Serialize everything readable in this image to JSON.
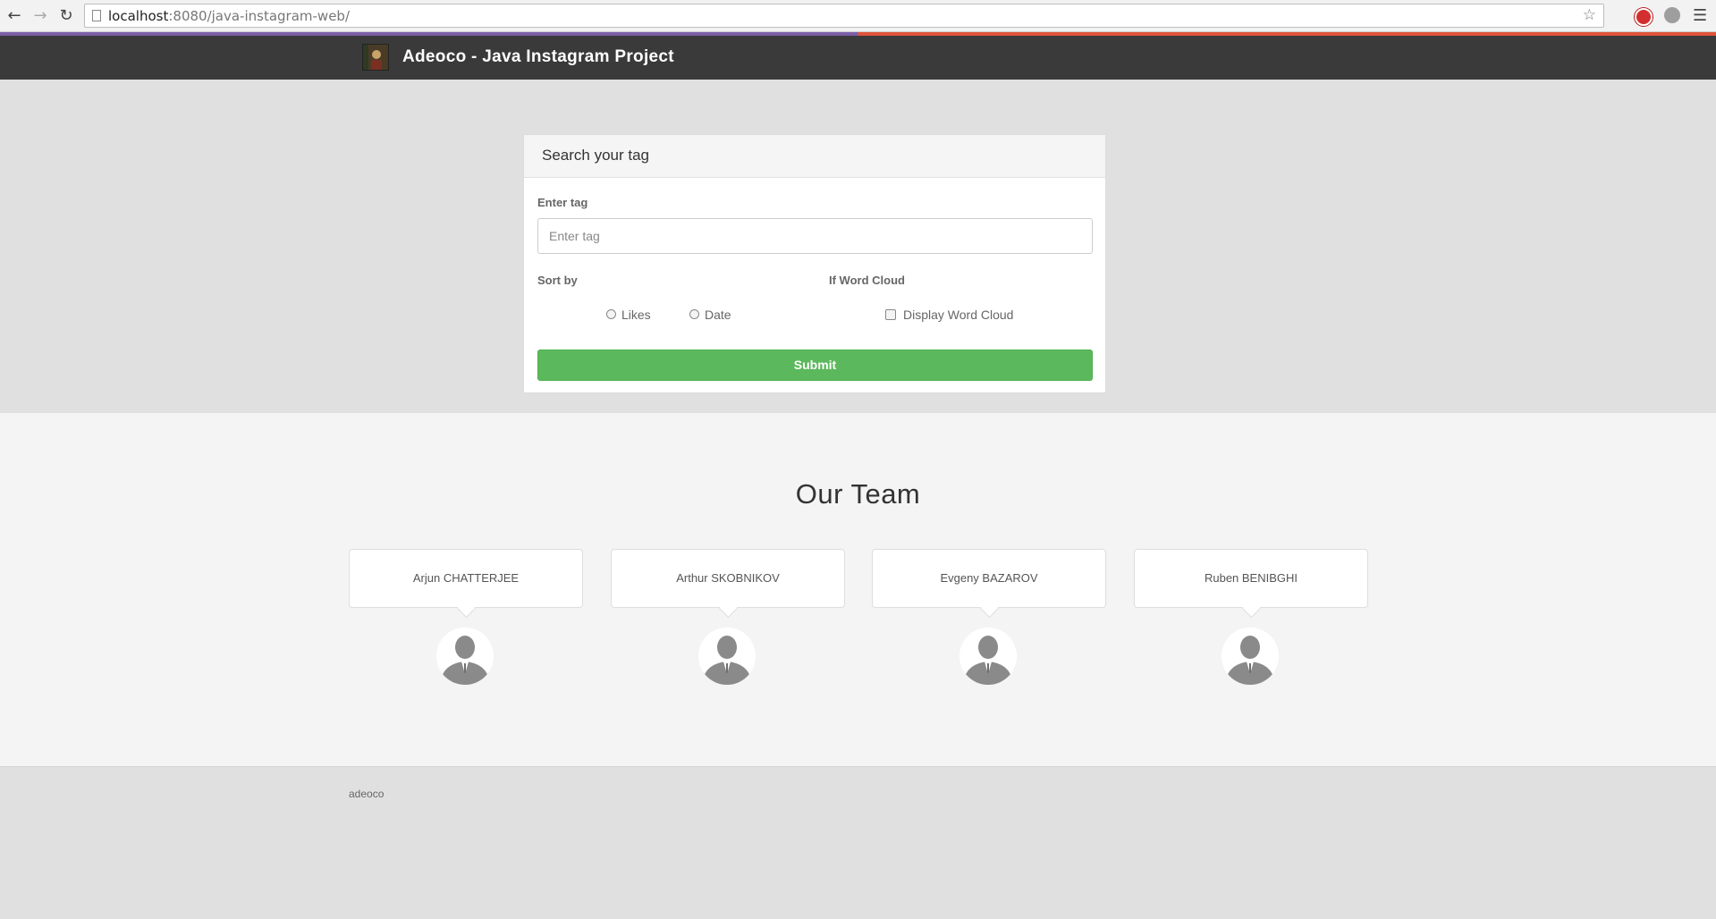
{
  "browser": {
    "url_host": "localhost",
    "url_rest": ":8080/java-instagram-web/",
    "back_icon": "back-arrow-icon",
    "forward_icon": "forward-arrow-icon",
    "reload_icon": "reload-icon"
  },
  "navbar": {
    "title": "Adeoco - Java Instagram Project"
  },
  "search_panel": {
    "heading": "Search your tag",
    "tag_label": "Enter tag",
    "tag_placeholder": "Enter tag",
    "tag_value": "",
    "sort_label": "Sort by",
    "sort_options": [
      "Likes",
      "Date"
    ],
    "wordcloud_label": "If Word Cloud",
    "wordcloud_option": "Display Word Cloud",
    "submit_label": "Submit"
  },
  "team": {
    "heading": "Our Team",
    "members": [
      {
        "name": "Arjun CHATTERJEE"
      },
      {
        "name": "Arthur SKOBNIKOV"
      },
      {
        "name": "Evgeny BAZAROV"
      },
      {
        "name": "Ruben BENIBGHI"
      }
    ]
  },
  "footer": {
    "text": "adeoco"
  },
  "colors": {
    "navbar": "#3a3a3a",
    "submit": "#5cb85c",
    "stripe_left": "#7b5ea7",
    "stripe_right": "#e0533b"
  }
}
